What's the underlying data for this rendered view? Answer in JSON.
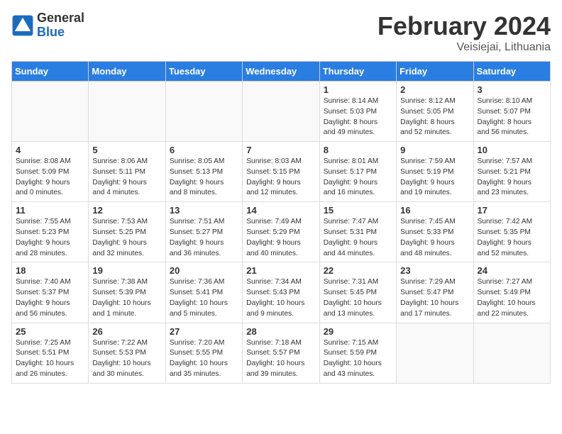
{
  "header": {
    "logo_general": "General",
    "logo_blue": "Blue",
    "title": "February 2024",
    "subtitle": "Veisiejai, Lithuania"
  },
  "weekdays": [
    "Sunday",
    "Monday",
    "Tuesday",
    "Wednesday",
    "Thursday",
    "Friday",
    "Saturday"
  ],
  "weeks": [
    [
      {
        "day": "",
        "info": ""
      },
      {
        "day": "",
        "info": ""
      },
      {
        "day": "",
        "info": ""
      },
      {
        "day": "",
        "info": ""
      },
      {
        "day": "1",
        "info": "Sunrise: 8:14 AM\nSunset: 5:03 PM\nDaylight: 8 hours\nand 49 minutes."
      },
      {
        "day": "2",
        "info": "Sunrise: 8:12 AM\nSunset: 5:05 PM\nDaylight: 8 hours\nand 52 minutes."
      },
      {
        "day": "3",
        "info": "Sunrise: 8:10 AM\nSunset: 5:07 PM\nDaylight: 8 hours\nand 56 minutes."
      }
    ],
    [
      {
        "day": "4",
        "info": "Sunrise: 8:08 AM\nSunset: 5:09 PM\nDaylight: 9 hours\nand 0 minutes."
      },
      {
        "day": "5",
        "info": "Sunrise: 8:06 AM\nSunset: 5:11 PM\nDaylight: 9 hours\nand 4 minutes."
      },
      {
        "day": "6",
        "info": "Sunrise: 8:05 AM\nSunset: 5:13 PM\nDaylight: 9 hours\nand 8 minutes."
      },
      {
        "day": "7",
        "info": "Sunrise: 8:03 AM\nSunset: 5:15 PM\nDaylight: 9 hours\nand 12 minutes."
      },
      {
        "day": "8",
        "info": "Sunrise: 8:01 AM\nSunset: 5:17 PM\nDaylight: 9 hours\nand 16 minutes."
      },
      {
        "day": "9",
        "info": "Sunrise: 7:59 AM\nSunset: 5:19 PM\nDaylight: 9 hours\nand 19 minutes."
      },
      {
        "day": "10",
        "info": "Sunrise: 7:57 AM\nSunset: 5:21 PM\nDaylight: 9 hours\nand 23 minutes."
      }
    ],
    [
      {
        "day": "11",
        "info": "Sunrise: 7:55 AM\nSunset: 5:23 PM\nDaylight: 9 hours\nand 28 minutes."
      },
      {
        "day": "12",
        "info": "Sunrise: 7:53 AM\nSunset: 5:25 PM\nDaylight: 9 hours\nand 32 minutes."
      },
      {
        "day": "13",
        "info": "Sunrise: 7:51 AM\nSunset: 5:27 PM\nDaylight: 9 hours\nand 36 minutes."
      },
      {
        "day": "14",
        "info": "Sunrise: 7:49 AM\nSunset: 5:29 PM\nDaylight: 9 hours\nand 40 minutes."
      },
      {
        "day": "15",
        "info": "Sunrise: 7:47 AM\nSunset: 5:31 PM\nDaylight: 9 hours\nand 44 minutes."
      },
      {
        "day": "16",
        "info": "Sunrise: 7:45 AM\nSunset: 5:33 PM\nDaylight: 9 hours\nand 48 minutes."
      },
      {
        "day": "17",
        "info": "Sunrise: 7:42 AM\nSunset: 5:35 PM\nDaylight: 9 hours\nand 52 minutes."
      }
    ],
    [
      {
        "day": "18",
        "info": "Sunrise: 7:40 AM\nSunset: 5:37 PM\nDaylight: 9 hours\nand 56 minutes."
      },
      {
        "day": "19",
        "info": "Sunrise: 7:38 AM\nSunset: 5:39 PM\nDaylight: 10 hours\nand 1 minute."
      },
      {
        "day": "20",
        "info": "Sunrise: 7:36 AM\nSunset: 5:41 PM\nDaylight: 10 hours\nand 5 minutes."
      },
      {
        "day": "21",
        "info": "Sunrise: 7:34 AM\nSunset: 5:43 PM\nDaylight: 10 hours\nand 9 minutes."
      },
      {
        "day": "22",
        "info": "Sunrise: 7:31 AM\nSunset: 5:45 PM\nDaylight: 10 hours\nand 13 minutes."
      },
      {
        "day": "23",
        "info": "Sunrise: 7:29 AM\nSunset: 5:47 PM\nDaylight: 10 hours\nand 17 minutes."
      },
      {
        "day": "24",
        "info": "Sunrise: 7:27 AM\nSunset: 5:49 PM\nDaylight: 10 hours\nand 22 minutes."
      }
    ],
    [
      {
        "day": "25",
        "info": "Sunrise: 7:25 AM\nSunset: 5:51 PM\nDaylight: 10 hours\nand 26 minutes."
      },
      {
        "day": "26",
        "info": "Sunrise: 7:22 AM\nSunset: 5:53 PM\nDaylight: 10 hours\nand 30 minutes."
      },
      {
        "day": "27",
        "info": "Sunrise: 7:20 AM\nSunset: 5:55 PM\nDaylight: 10 hours\nand 35 minutes."
      },
      {
        "day": "28",
        "info": "Sunrise: 7:18 AM\nSunset: 5:57 PM\nDaylight: 10 hours\nand 39 minutes."
      },
      {
        "day": "29",
        "info": "Sunrise: 7:15 AM\nSunset: 5:59 PM\nDaylight: 10 hours\nand 43 minutes."
      },
      {
        "day": "",
        "info": ""
      },
      {
        "day": "",
        "info": ""
      }
    ]
  ]
}
